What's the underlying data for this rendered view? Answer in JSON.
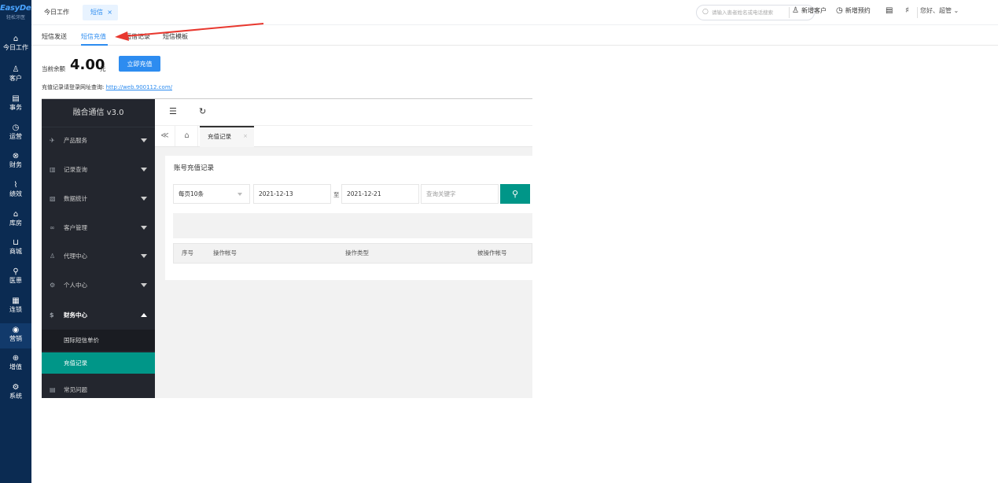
{
  "brand": {
    "name": "EasyDent",
    "sub": "轻松牙医"
  },
  "sidebar": {
    "items": [
      {
        "icon": "⌂",
        "label": "今日工作"
      },
      {
        "icon": "♙",
        "label": "客户"
      },
      {
        "icon": "▤",
        "label": "事务"
      },
      {
        "icon": "◷",
        "label": "运营"
      },
      {
        "icon": "⊗",
        "label": "财务"
      },
      {
        "icon": "⌇",
        "label": "绩效"
      },
      {
        "icon": "⌂",
        "label": "库房"
      },
      {
        "icon": "⊔",
        "label": "商城"
      },
      {
        "icon": "⚲",
        "label": "医患"
      },
      {
        "icon": "▦",
        "label": "连锁"
      },
      {
        "icon": "◉",
        "label": "营销"
      },
      {
        "icon": "⊕",
        "label": "增值"
      },
      {
        "icon": "⚙",
        "label": "系统"
      }
    ]
  },
  "topbar": {
    "home_tab": "今日工作",
    "sms_tab": "短信",
    "sms_tab_close": "×",
    "search_placeholder": "请输入患者姓名或电话搜索",
    "new_customer": "新增客户",
    "new_appointment": "新增预约",
    "user": "您好、超管"
  },
  "subtabs": [
    "短信发送",
    "短信充值",
    "短信记录",
    "短信模板"
  ],
  "balance": {
    "label": "当前余额",
    "value": "4.00",
    "unit": "元",
    "button": "立即充值",
    "hint_prefix": "充值记录请登录网址查询:",
    "hint_link": "http://web.900112.com/"
  },
  "embed": {
    "title": "融合通信 v3.0",
    "menu": [
      {
        "icon": "✈",
        "label": "产品服务"
      },
      {
        "icon": "▥",
        "label": "记录查询"
      },
      {
        "icon": "▧",
        "label": "数据统计"
      },
      {
        "icon": "∞",
        "label": "客户管理"
      },
      {
        "icon": "♙",
        "label": "代理中心"
      },
      {
        "icon": "⚙",
        "label": "个人中心"
      },
      {
        "icon": "$",
        "label": "财务中心"
      }
    ],
    "submenu": [
      "国际短信单价",
      "充值记录"
    ],
    "last_menu": {
      "icon": "▤",
      "label": "常见问题"
    },
    "toolbar": {
      "menu_icon": "☰",
      "refresh_icon": "↻"
    },
    "tabs": {
      "back": "≪",
      "home": "⌂",
      "active": "充值记录",
      "active_close": "×"
    },
    "card": {
      "title": "账号充值记录",
      "page_size": "每页10条",
      "date_from": "2021-12-13",
      "date_sep": "至",
      "date_to": "2021-12-21",
      "keyword_placeholder": "查询关键字",
      "search_icon": "⚲",
      "columns": [
        "序号",
        "操作帐号",
        "操作类型",
        "被操作帐号"
      ]
    }
  },
  "colors": {
    "sidebar_bg": "#0b2b52",
    "accent": "#2d8cf0",
    "teal": "#009688",
    "annotation": "#e8382f"
  }
}
